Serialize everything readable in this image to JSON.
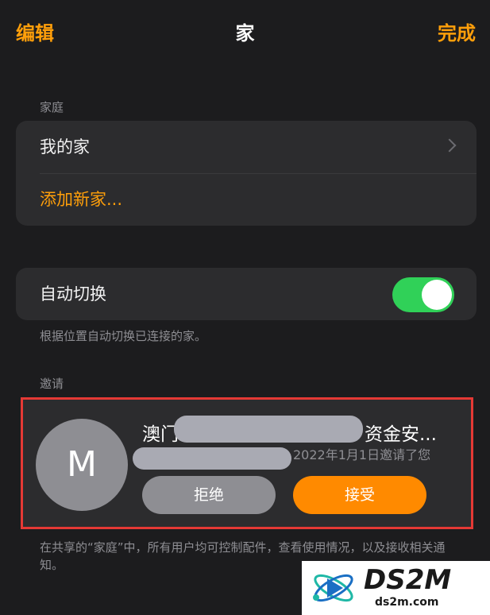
{
  "nav": {
    "edit_label": "编辑",
    "title": "家",
    "done_label": "完成"
  },
  "home_section": {
    "label": "家庭",
    "items": [
      {
        "label": "我的家"
      },
      {
        "label": "添加新家..."
      }
    ]
  },
  "auto_switch": {
    "label": "自动切换",
    "enabled": true,
    "description": "根据位置自动切换已连接的家。"
  },
  "invitations": {
    "label": "邀请",
    "avatar_initial": "M",
    "name_prefix": "澳门",
    "name_suffix": "资金安...",
    "date_text": "2022年1月1日邀请了您",
    "decline_label": "拒绝",
    "accept_label": "接受"
  },
  "footer_note": "在共享的“家庭”中，所有用户均可控制配件，查看使用情况，以及接收相关通知。",
  "watermark": {
    "title": "DS2M",
    "subtitle": "ds2m.com"
  },
  "colors": {
    "accent": "#ff9f0a",
    "toggle_on": "#30d158",
    "accept_button": "#ff8a00",
    "highlight_border": "#e53935"
  }
}
